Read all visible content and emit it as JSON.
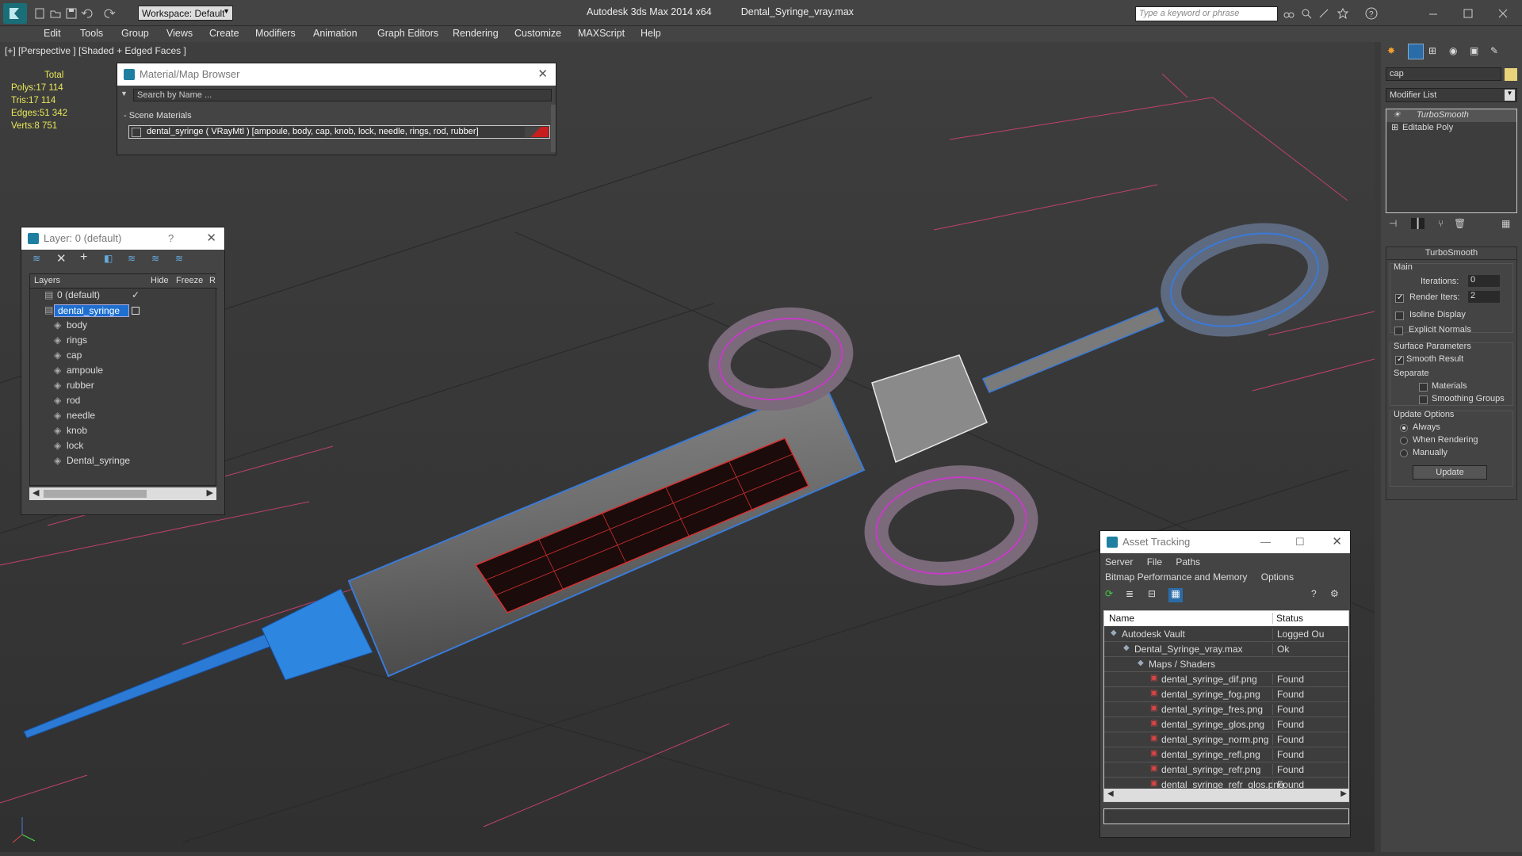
{
  "app": {
    "title": "Autodesk 3ds Max  2014 x64",
    "filename": "Dental_Syringe_vray.max",
    "workspace": "Workspace: Default",
    "search_placeholder": "Type a keyword or phrase"
  },
  "menu": [
    "Edit",
    "Tools",
    "Group",
    "Views",
    "Create",
    "Modifiers",
    "Animation",
    "Graph Editors",
    "Rendering",
    "Customize",
    "MAXScript",
    "Help"
  ],
  "viewport": {
    "label": "[+] [Perspective ] [Shaded + Edged Faces ]",
    "stats": {
      "header": "Total",
      "polys_label": "Polys:",
      "polys": "17 114",
      "tris_label": "Tris:",
      "tris": "17 114",
      "edges_label": "Edges:",
      "edges": "51 342",
      "verts_label": "Verts:",
      "verts": "8 751"
    }
  },
  "material_browser": {
    "title": "Material/Map Browser",
    "search_placeholder": "Search by Name ...",
    "group": "- Scene Materials",
    "material": "dental_syringe  ( VRayMtl )  [ampoule, body, cap, knob, lock, needle, rings, rod, rubber]"
  },
  "layer_panel": {
    "title": "Layer: 0 (default)",
    "help": "?",
    "col_layers": "Layers",
    "col_hide": "Hide",
    "col_freeze": "Freeze",
    "col_r": "R",
    "default_layer": "0 (default)",
    "selected_layer": "dental_syringe",
    "objects": [
      "body",
      "rings",
      "cap",
      "ampoule",
      "rubber",
      "rod",
      "needle",
      "knob",
      "lock",
      "Dental_syringe"
    ]
  },
  "command_panel": {
    "search_value": "cap",
    "modifier_list": "Modifier List",
    "stack": [
      "TurboSmooth",
      "Editable Poly"
    ],
    "rollout": "TurboSmooth",
    "main": "Main",
    "iterations_label": "Iterations:",
    "iterations": "0",
    "render_iters_label": "Render Iters:",
    "render_iters": "2",
    "isoline": "Isoline Display",
    "explicit_normals": "Explicit Normals",
    "surface_params": "Surface Parameters",
    "smooth_result": "Smooth Result",
    "separate": "Separate",
    "materials": "Materials",
    "smoothing_groups": "Smoothing Groups",
    "update_options": "Update Options",
    "always": "Always",
    "when_rendering": "When Rendering",
    "manually": "Manually",
    "update_button": "Update"
  },
  "asset_tracking": {
    "title": "Asset Tracking",
    "menu1": [
      "Server",
      "File",
      "Paths"
    ],
    "menu2": [
      "Bitmap Performance and Memory",
      "Options"
    ],
    "col_name": "Name",
    "col_status": "Status",
    "rows": [
      {
        "name": "Autodesk Vault",
        "status": "Logged Ou"
      },
      {
        "name": "Dental_Syringe_vray.max",
        "status": "Ok"
      },
      {
        "name": "Maps / Shaders",
        "status": ""
      },
      {
        "name": "dental_syringe_dif.png",
        "status": "Found"
      },
      {
        "name": "dental_syringe_fog.png",
        "status": "Found"
      },
      {
        "name": "dental_syringe_fres.png",
        "status": "Found"
      },
      {
        "name": "dental_syringe_glos.png",
        "status": "Found"
      },
      {
        "name": "dental_syringe_norm.png",
        "status": "Found"
      },
      {
        "name": "dental_syringe_refl.png",
        "status": "Found"
      },
      {
        "name": "dental_syringe_refr.png",
        "status": "Found"
      },
      {
        "name": "dental_syringe_refr_glos.png",
        "status": "Found"
      }
    ]
  },
  "colors": {
    "accent_blue": "#2b7bd6",
    "wire_blue": "#3a7ad8",
    "wire_magenta": "#c63cc6",
    "stats_yellow": "#e8e85a",
    "selection": "#1e6fd0"
  }
}
